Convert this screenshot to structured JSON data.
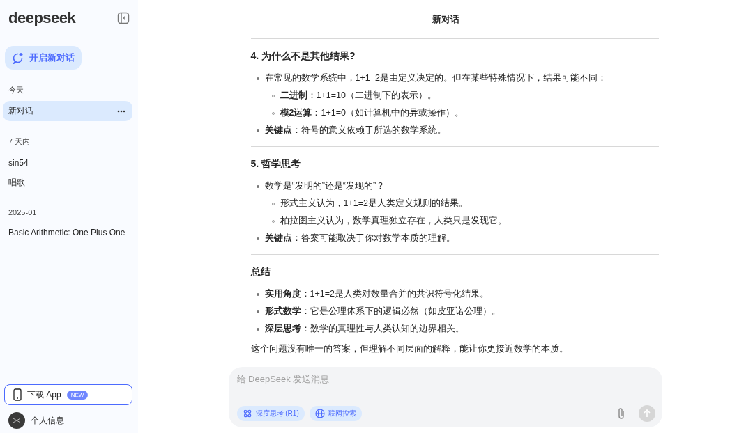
{
  "sidebar": {
    "logo": "deepseek",
    "new_chat_button": "开启新对话",
    "groups": [
      {
        "heading": "今天",
        "items": [
          {
            "title": "新对话",
            "selected": true
          }
        ]
      },
      {
        "heading": "7 天内",
        "items": [
          {
            "title": "sin54",
            "selected": false
          },
          {
            "title": "唱歌",
            "selected": false
          }
        ]
      },
      {
        "heading": "2025-01",
        "items": [
          {
            "title": "Basic Arithmetic: One Plus One",
            "selected": false
          }
        ]
      }
    ],
    "download_app": {
      "label": "下载 App",
      "badge": "NEW"
    },
    "profile": {
      "label": "个人信息"
    }
  },
  "chat": {
    "title": "新对话",
    "sections": [
      {
        "heading": "4. 为什么不是其他结果?",
        "bullets": [
          {
            "text": "在常见的数学系统中，1+1=2是由定义决定的。但在某些特殊情况下，结果可能不同：",
            "children": [
              {
                "text": "**二进制**：1+1=10（二进制下的表示）。"
              },
              {
                "text": "**模2运算**：1+1=0（如计算机中的异或操作）。"
              }
            ]
          },
          {
            "text": "**关键点**：符号的意义依赖于所选的数学系统。"
          }
        ]
      },
      {
        "heading": "5. 哲学思考",
        "bullets": [
          {
            "text": "数学是“发明的”还是“发现的”？",
            "children": [
              {
                "text": "形式主义认为，1+1=2是人类定义规则的结果。"
              },
              {
                "text": "柏拉图主义认为，数学真理独立存在，人类只是发现它。"
              }
            ]
          },
          {
            "text": "**关键点**：答案可能取决于你对数学本质的理解。"
          }
        ]
      },
      {
        "heading": "总结",
        "bullets": [
          {
            "text": "**实用角度**：1+1=2是人类对数量合并的共识符号化结果。"
          },
          {
            "text": "**形式数学**：它是公理体系下的逻辑必然（如皮亚诺公理）。"
          },
          {
            "text": "**深层思考**：数学的真理性与人类认知的边界相关。"
          }
        ]
      }
    ],
    "closing": "这个问题没有唯一的答案，但理解不同层面的解释，能让你更接近数学的本质。"
  },
  "composer": {
    "placeholder": "给 DeepSeek 发送消息",
    "toggles": [
      {
        "label": "深度思考 (R1)",
        "on": true
      },
      {
        "label": "联网搜索",
        "on": true
      }
    ]
  }
}
